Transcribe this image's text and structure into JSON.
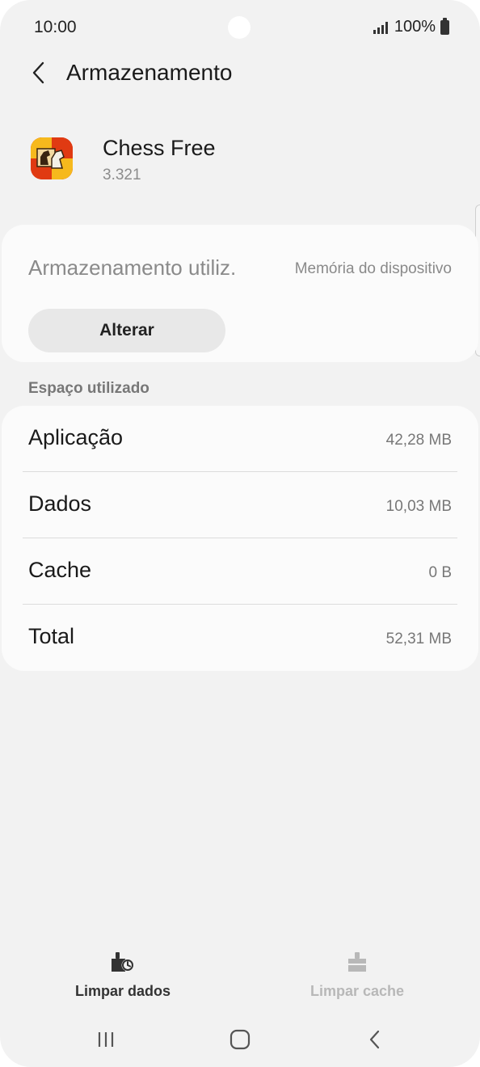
{
  "status_bar": {
    "time": "10:00",
    "battery_text": "100%"
  },
  "header": {
    "title": "Armazenamento",
    "back_icon": "chevron-left-icon"
  },
  "app": {
    "name": "Chess Free",
    "version": "3.321",
    "icon": "chess-app-icon"
  },
  "storage": {
    "label": "Armazenamento utiliz.",
    "value": "Memória do dispositivo",
    "change_button": "Alterar"
  },
  "space_used": {
    "section_title": "Espaço utilizado",
    "rows": [
      {
        "label": "Aplicação",
        "value": "42,28 MB"
      },
      {
        "label": "Dados",
        "value": "10,03 MB"
      },
      {
        "label": "Cache",
        "value": "0 B"
      },
      {
        "label": "Total",
        "value": "52,31 MB"
      }
    ]
  },
  "actions": {
    "clear_data": "Limpar dados",
    "clear_cache": "Limpar cache"
  },
  "colors": {
    "background": "#f2f2f2",
    "card": "#fbfbfb",
    "disabled_text": "#b8b8b8",
    "accent_app_icon": "#e03a12"
  }
}
